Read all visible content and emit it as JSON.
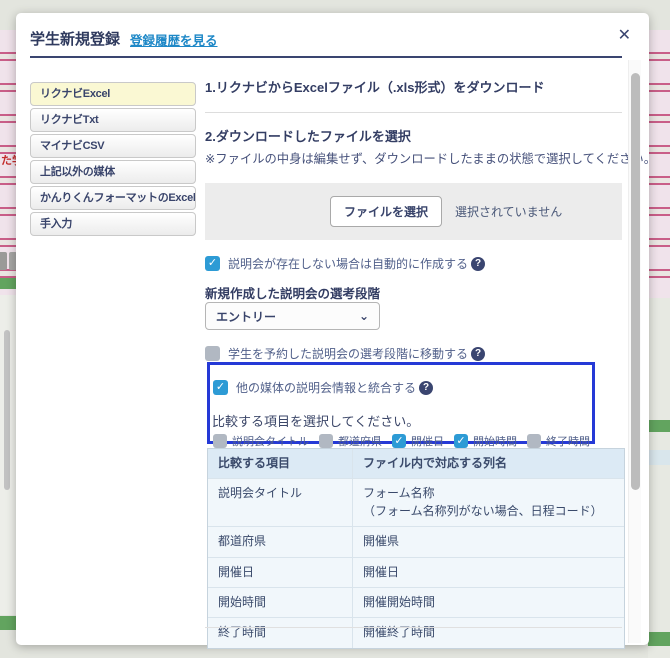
{
  "icons": {
    "close": "✕",
    "check": "✓",
    "help": "?",
    "chevron_down": "⌄"
  },
  "background": {
    "partial_text": "た学"
  },
  "modal": {
    "title": "学生新規登録",
    "history_link": "登録履歴を見る"
  },
  "sidebar": {
    "items": [
      {
        "label": "リクナビExcel",
        "active": true
      },
      {
        "label": "リクナビTxt",
        "active": false
      },
      {
        "label": "マイナビCSV",
        "active": false
      },
      {
        "label": "上記以外の媒体",
        "active": false
      },
      {
        "label": "かんりくんフォーマットのExcel",
        "active": false
      },
      {
        "label": "手入力",
        "active": false
      }
    ]
  },
  "main": {
    "step1_title": "1.リクナビからExcelファイル（.xls形式）をダウンロード",
    "step2_title": "2.ダウンロードしたファイルを選択",
    "step2_note": "※ファイルの中身は編集せず、ダウンロードしたままの状態で選択してください。",
    "file_button": "ファイルを選択",
    "file_status": "選択されていません",
    "checkbox_auto_create": {
      "label": "説明会が存在しない場合は自動的に作成する",
      "checked": true
    },
    "stage_label": "新規作成した説明会の選考段階",
    "stage_select_value": "エントリー",
    "checkbox_move_stage": {
      "label": "学生を予約した説明会の選考段階に移動する",
      "checked": false
    },
    "merge_box": {
      "checkbox_merge": {
        "label": "他の媒体の説明会情報と統合する",
        "checked": true
      },
      "compare_prompt": "比較する項目を選択してください。",
      "compare_options": [
        {
          "label": "説明会タイトル",
          "checked": false
        },
        {
          "label": "都道府県",
          "checked": false
        },
        {
          "label": "開催日",
          "checked": true
        },
        {
          "label": "開始時間",
          "checked": true
        },
        {
          "label": "終了時間",
          "checked": false
        }
      ]
    },
    "table": {
      "headers": [
        "比較する項目",
        "ファイル内で対応する列名"
      ],
      "rows": [
        {
          "item": "説明会タイトル",
          "column": "フォーム名称",
          "column_note": "（フォーム名称列がない場合、日程コード）"
        },
        {
          "item": "都道府県",
          "column": "開催県",
          "column_note": ""
        },
        {
          "item": "開催日",
          "column": "開催日",
          "column_note": ""
        },
        {
          "item": "開始時間",
          "column": "開催開始時間",
          "column_note": ""
        },
        {
          "item": "終了時間",
          "column": "開催終了時間",
          "column_note": ""
        }
      ]
    }
  }
}
